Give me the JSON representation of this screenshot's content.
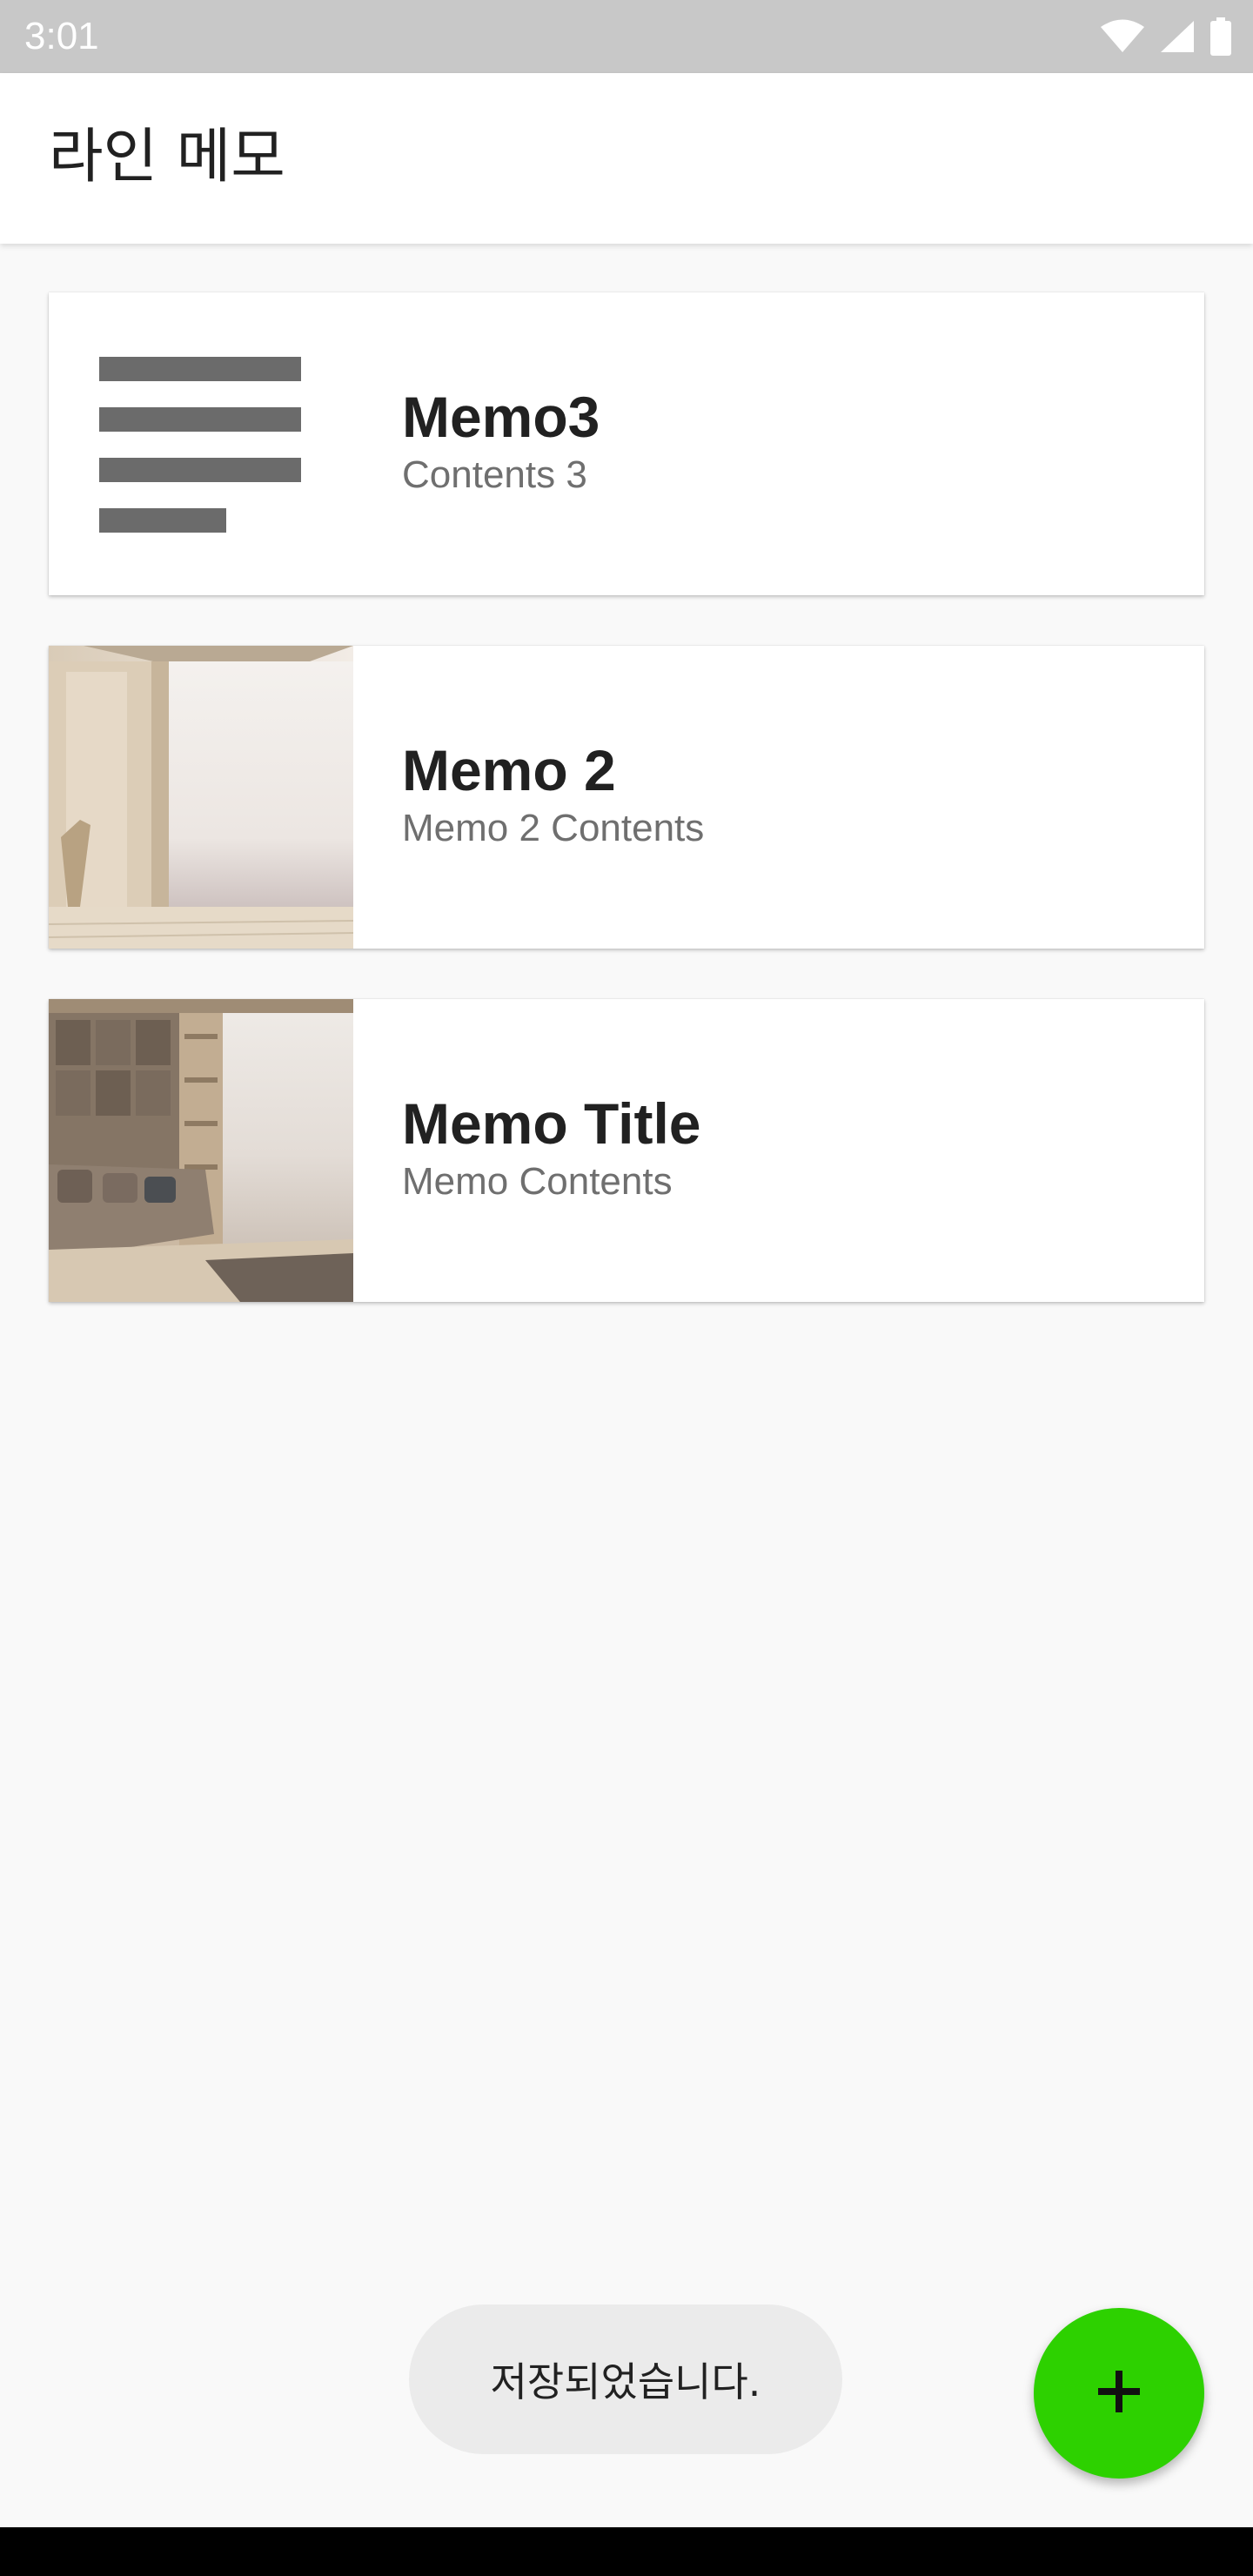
{
  "status_bar": {
    "time": "3:01",
    "icons": [
      "wifi-icon",
      "signal-icon",
      "battery-icon"
    ]
  },
  "app_bar": {
    "title": "라인 메모"
  },
  "memos": [
    {
      "title": "Memo3",
      "contents": "Contents 3",
      "thumbnail": "text-lines-icon"
    },
    {
      "title": "Memo 2",
      "contents": "Memo 2 Contents",
      "thumbnail": "room-photo"
    },
    {
      "title": "Memo Title",
      "contents": "Memo Contents",
      "thumbnail": "living-room-photo"
    }
  ],
  "toast": {
    "message": "저장되었습니다."
  },
  "fab": {
    "icon": "plus-icon"
  },
  "colors": {
    "accent": "#2dd100",
    "status_bar": "#c8c8c8",
    "background": "#f9f9f9",
    "secondary_text": "#6f6f6f"
  }
}
